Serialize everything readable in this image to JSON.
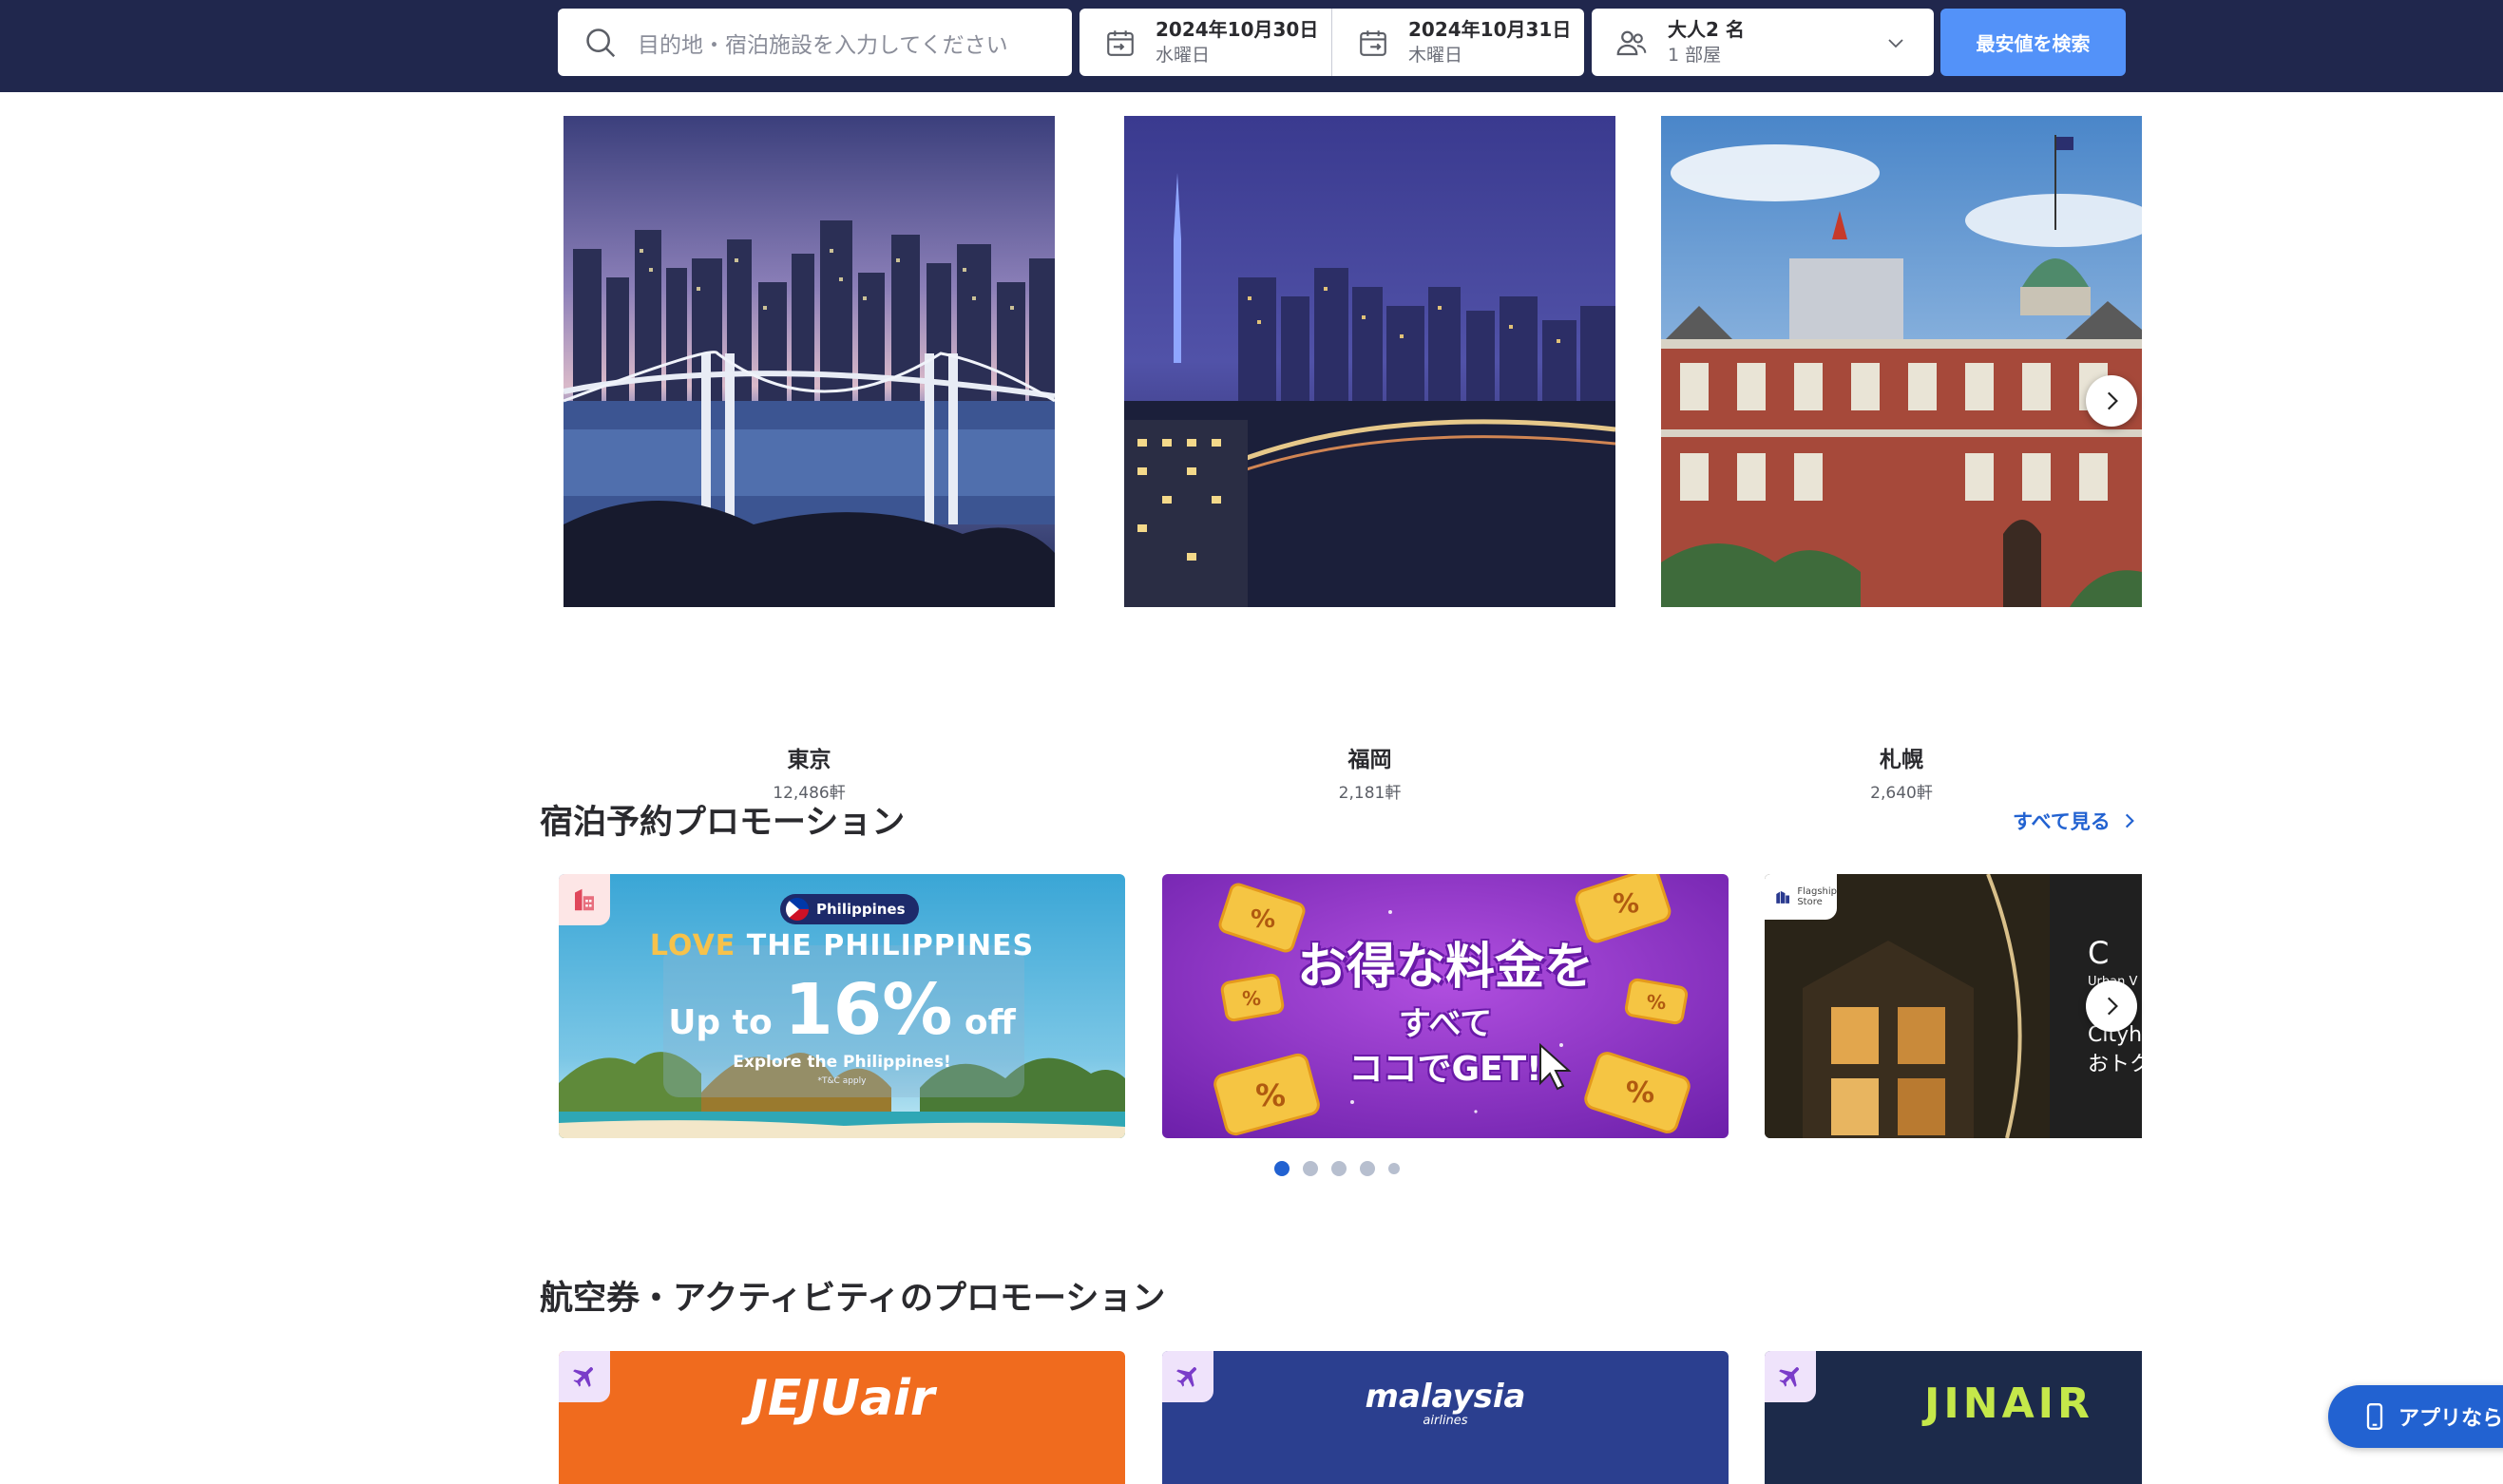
{
  "header": {
    "destination_placeholder": "目的地・宿泊施設を入力してください",
    "checkin_date": "2024年10月30日",
    "checkin_day": "水曜日",
    "checkout_date": "2024年10月31日",
    "checkout_day": "木曜日",
    "guests": "大人2 名",
    "rooms": "1 部屋",
    "search_button": "最安値を検索"
  },
  "destinations": [
    {
      "name": "東京",
      "count": "12,486軒"
    },
    {
      "name": "福岡",
      "count": "2,181軒"
    },
    {
      "name": "札幌",
      "count": "2,640軒"
    }
  ],
  "hotel_promos": {
    "title": "宿泊予約プロモーション",
    "see_all": "すべて見る",
    "philippines": {
      "pill": "Philippines",
      "headline_love": "LOVE",
      "headline_rest": " THE PHILIPPINES",
      "up_to": "Up to ",
      "percent": "16%",
      "off": " off",
      "sub": "Explore the Philippines!",
      "tc": "*T&C apply"
    },
    "deals": {
      "line1": "お得な料金を",
      "line2": "すべて",
      "line3": "ココでGET!"
    },
    "flagship": {
      "tag_line1": "Flagship",
      "tag_line2": "Store",
      "brand": "C",
      "brand_sub": "Urban V",
      "line1": "Cityho",
      "line2": "おトク"
    },
    "carousel_dots": 5,
    "active_dot": 0
  },
  "air_promos": {
    "title": "航空券・アクティビティのプロモーション",
    "cards": [
      {
        "logo": "JEJUair",
        "color": "#f06b1e"
      },
      {
        "logo": "malaysia",
        "logo_sub": "airlines",
        "color": "#2b3f8f"
      },
      {
        "logo": "JINAIR",
        "color": "#1c2a4a"
      }
    ]
  },
  "app_pill": "アプリなら"
}
